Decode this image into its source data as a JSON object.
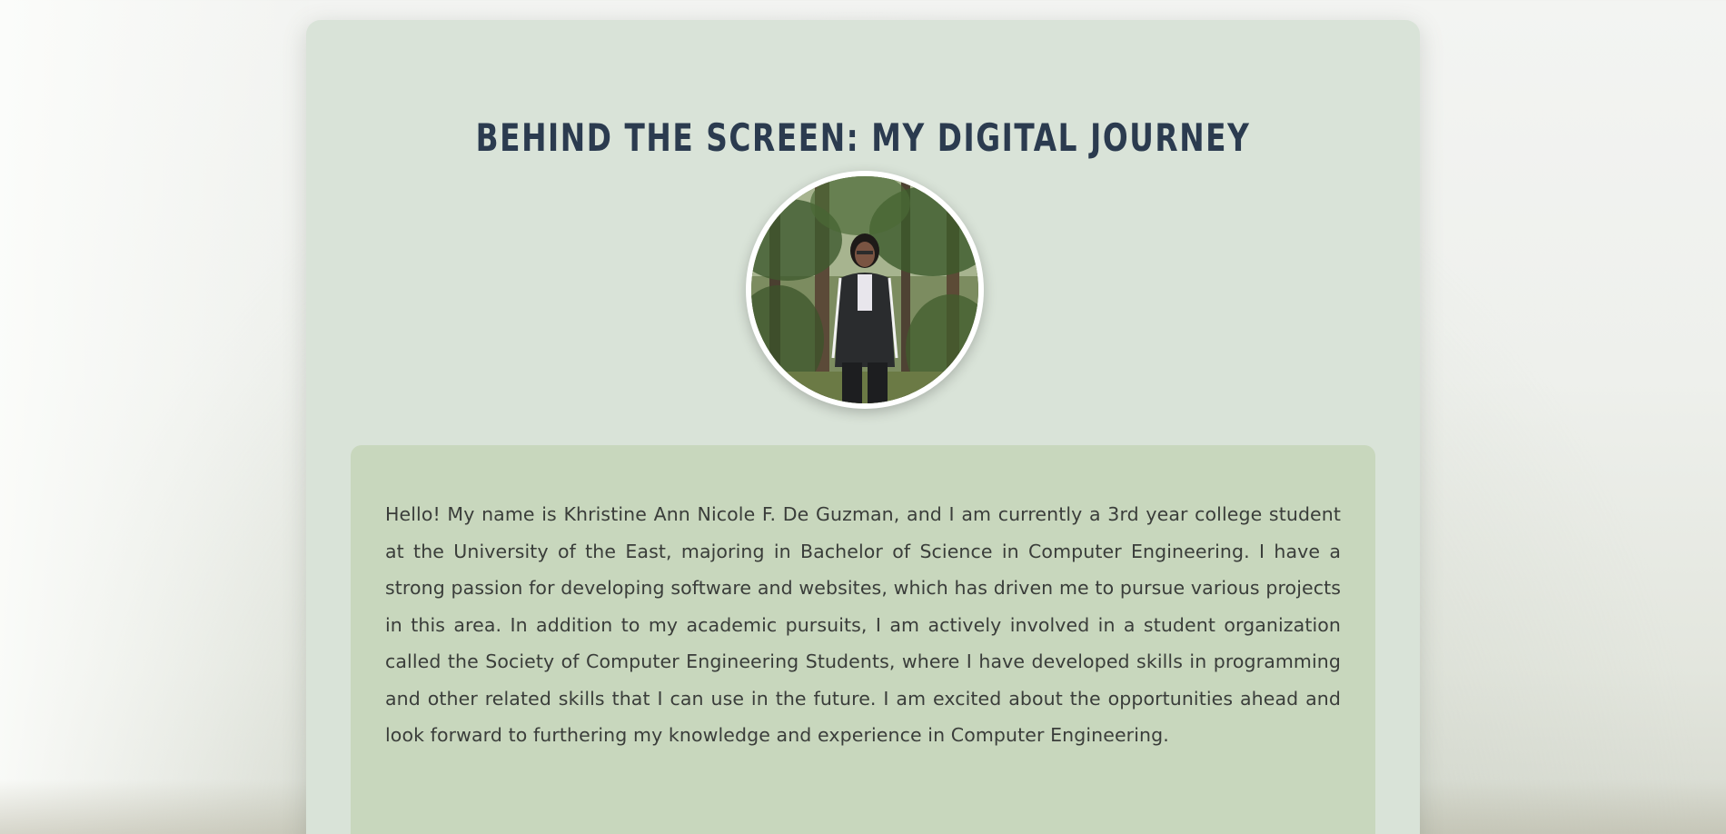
{
  "page": {
    "title": "BEHIND THE SCREEN: MY DIGITAL JOURNEY",
    "bio": "Hello! My name is Khristine Ann Nicole F. De Guzman, and I am currently a 3rd year college student at the University of the East, majoring in Bachelor of Science in Computer Engineering. I have a strong passion for developing software and websites, which has driven me to pursue various projects in this area. In addition to my academic pursuits, I am actively involved in a student organization called the Society of Computer Engineering Students, where I have developed skills in programming and other related skills that I can use in the future. I am excited about the opportunities ahead and look forward to furthering my knowledge and experience in Computer Engineering."
  },
  "colors": {
    "card_background": "#d9e3d8",
    "bio_background": "#c8d7bd",
    "title_color": "#2b3b4f",
    "text_color": "#3a3d3a"
  }
}
